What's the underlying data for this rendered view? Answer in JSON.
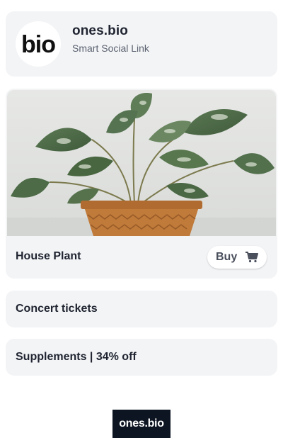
{
  "profile": {
    "name": "ones.bio",
    "subtitle": "Smart Social Link",
    "avatar_text": "bio"
  },
  "product": {
    "title": "House Plant",
    "buy_label": "Buy",
    "image_icon": "potted-plant-photo",
    "cart_icon": "shopping-cart-icon"
  },
  "links": [
    {
      "label": "Concert tickets"
    },
    {
      "label": "Supplements | 34% off"
    }
  ],
  "footer": {
    "logo_text": "ones.bio"
  },
  "colors": {
    "card_background": "#f3f4f6",
    "text_primary": "#1f2430",
    "text_secondary": "#5b6270",
    "footer_logo_background": "#0d1522",
    "pot": "#c07a3a"
  }
}
